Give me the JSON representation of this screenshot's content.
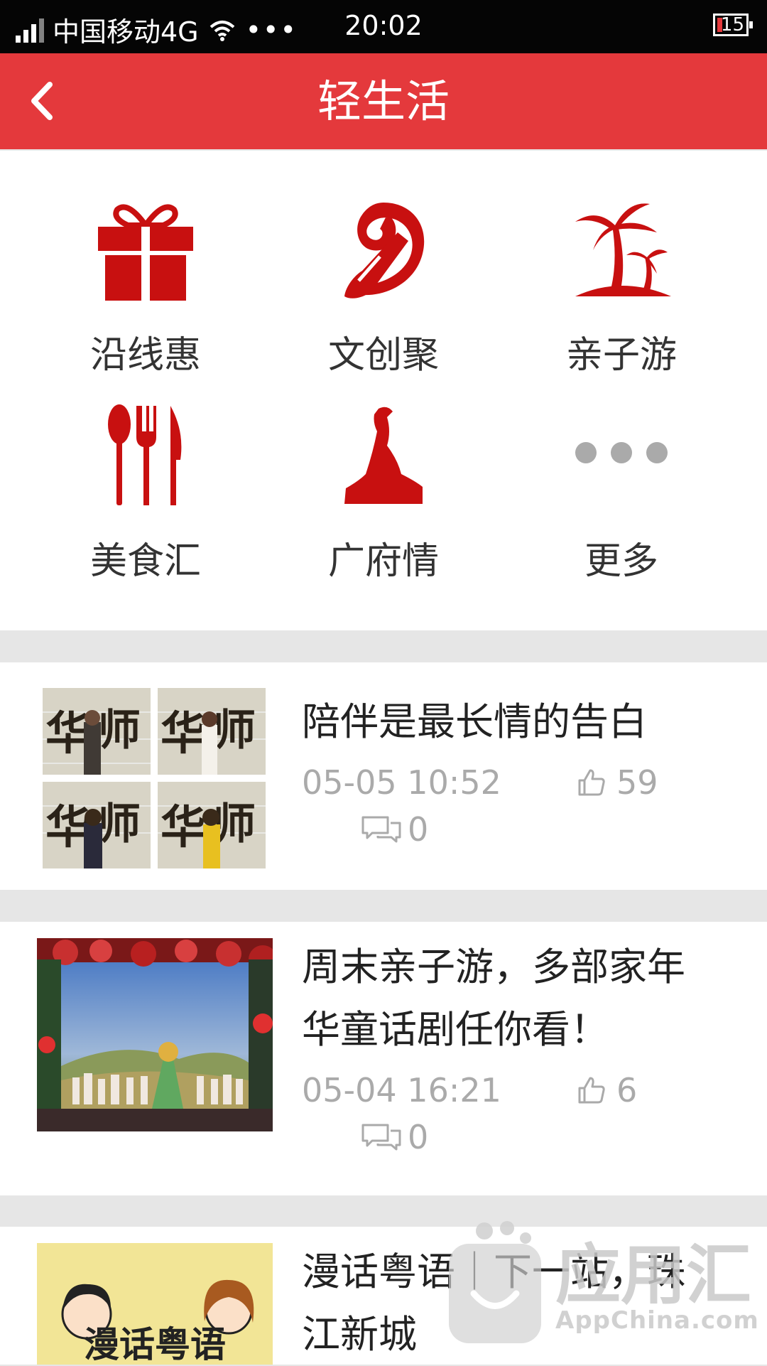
{
  "status_bar": {
    "carrier": "中国移动4G",
    "time": "20:02",
    "battery": "15",
    "dots": "•••"
  },
  "header": {
    "title": "轻生活"
  },
  "categories": [
    {
      "label": "沿线惠",
      "icon": "gift-icon"
    },
    {
      "label": "文创聚",
      "icon": "brush-icon"
    },
    {
      "label": "亲子游",
      "icon": "palm-tree-icon"
    },
    {
      "label": "美食汇",
      "icon": "cutlery-icon"
    },
    {
      "label": "广府情",
      "icon": "goat-statue-icon"
    },
    {
      "label": "更多",
      "icon": "more-icon"
    }
  ],
  "articles": [
    {
      "title": "陪伴是最长情的告白",
      "date": "05-05",
      "time": "10:52",
      "likes": "59",
      "comments": "0"
    },
    {
      "title_line1": "周末亲子游，多部家年",
      "title_line2": "华童话剧任你看！",
      "date": "05-04",
      "time": "16:21",
      "likes": "6",
      "comments": "0"
    },
    {
      "title_line1": "漫话粤语｜下一站，珠",
      "title_line2": "江新城",
      "thumb_text": "漫话粤语"
    }
  ],
  "thumb1_text": [
    "华",
    "师"
  ],
  "watermark": {
    "name": "应用汇",
    "site": "AppChina.com"
  },
  "colors": {
    "accent": "#e4393c",
    "icon_red": "#c81010",
    "meta_gray": "#aaaaaa"
  }
}
